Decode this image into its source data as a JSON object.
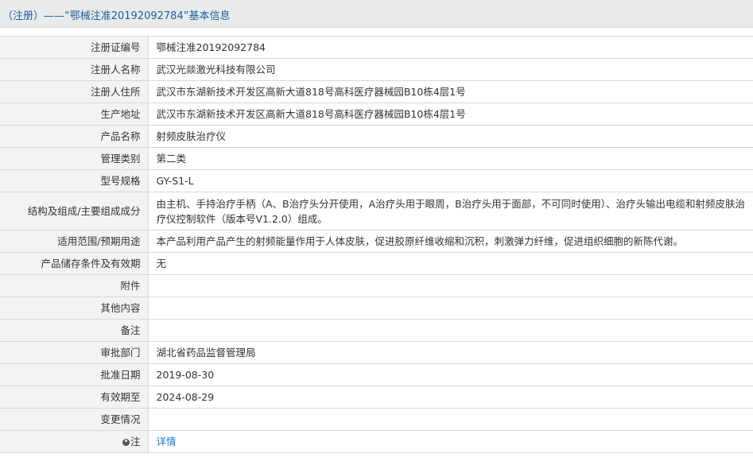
{
  "header": {
    "title": "（注册）——“鄂械注准20192092784”基本信息"
  },
  "rows": [
    {
      "label": "注册证编号",
      "value": "鄂械注准20192092784"
    },
    {
      "label": "注册人名称",
      "value": "武汉光燚激光科技有限公司"
    },
    {
      "label": "注册人住所",
      "value": "武汉市东湖新技术开发区高新大道818号高科医疗器械园B10栋4层1号"
    },
    {
      "label": "生产地址",
      "value": "武汉市东湖新技术开发区高新大道818号高科医疗器械园B10栋4层1号"
    },
    {
      "label": "产品名称",
      "value": "射频皮肤治疗仪"
    },
    {
      "label": "管理类别",
      "value": "第二类"
    },
    {
      "label": "型号规格",
      "value": "GY-S1-L"
    },
    {
      "label": "结构及组成/主要组成成分",
      "value": "由主机、手持治疗手柄（A、B治疗头分开使用，A治疗头用于眼周，B治疗头用于面部，不可同时使用）、治疗头输出电缆和射频皮肤治疗仪控制软件（版本号V1.2.0）组成。"
    },
    {
      "label": "适用范围/预期用途",
      "value": "本产品利用产品产生的射频能量作用于人体皮肤，促进胶原纤维收缩和沉积，刺激弹力纤维，促进组织细胞的新陈代谢。"
    },
    {
      "label": "产品储存条件及有效期",
      "value": "无"
    },
    {
      "label": "附件",
      "value": ""
    },
    {
      "label": "其他内容",
      "value": ""
    },
    {
      "label": "备注",
      "value": ""
    },
    {
      "label": "审批部门",
      "value": "湖北省药品监督管理局"
    },
    {
      "label": "批准日期",
      "value": "2019-08-30"
    },
    {
      "label": "有效期至",
      "value": "2024-08-29"
    },
    {
      "label": "变更情况",
      "value": ""
    }
  ],
  "note_row": {
    "label": "注",
    "link_text": "详情",
    "icon": "note-icon"
  }
}
